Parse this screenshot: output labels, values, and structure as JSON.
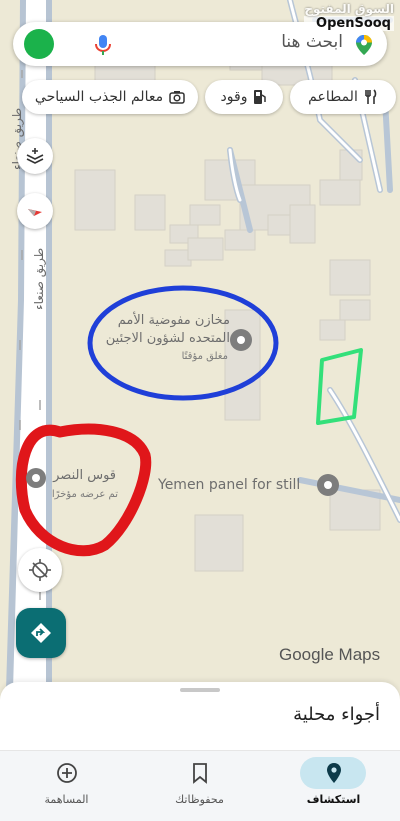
{
  "watermark": {
    "arabic": "السوق المفتوح",
    "english": "OpenSooq"
  },
  "search": {
    "placeholder": "ابحث هنا"
  },
  "chips": [
    {
      "label": "المطاعم",
      "icon": "fork-knife-icon"
    },
    {
      "label": "وقود",
      "icon": "gas-station-icon"
    },
    {
      "label": "معالم الجذب السياحي",
      "icon": "camera-icon"
    }
  ],
  "map": {
    "roads": [
      "طريق صنعاء",
      "طريق صنعاء"
    ],
    "places": [
      {
        "name": "مخازن مفوضية الأمم المتحده لشؤون الاجئين",
        "status": "مغلق مؤقتًا",
        "icon": "place-pin-icon"
      },
      {
        "name": "Yemen panel for still",
        "icon": "place-pin-icon"
      },
      {
        "name": "قوس النصر",
        "status": "تم عرضه مؤخرًا",
        "icon": "place-pin-icon"
      }
    ],
    "annotations": [
      {
        "shape": "circle",
        "color": "#1f3fd8"
      },
      {
        "shape": "circle",
        "color": "#e0161a"
      },
      {
        "shape": "quadrilateral",
        "color": "#33e07a"
      }
    ],
    "logo": "Google Maps"
  },
  "sheet": {
    "title": "أجواء محلية"
  },
  "nav": [
    {
      "label": "المساهمة",
      "icon": "add-circle-icon",
      "active": false
    },
    {
      "label": "محفوظاتك",
      "icon": "bookmark-icon",
      "active": false
    },
    {
      "label": "استكشاف",
      "icon": "explore-pin-icon",
      "active": true
    }
  ],
  "colors": {
    "accent": "#0b6e73",
    "active_pill": "#c8e6f0",
    "map_bg": "#ede9d6",
    "road": "#ffffff",
    "minor_road": "#b8c6d6"
  }
}
